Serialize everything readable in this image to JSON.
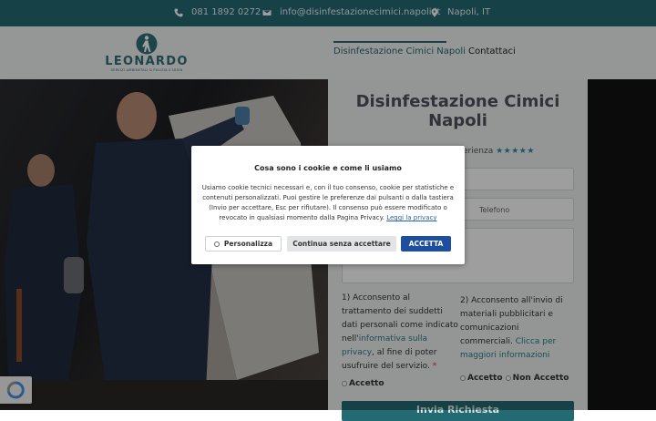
{
  "topbar": {
    "phone": "081 1892 0272",
    "email": "info@disinfestazionecimici.napoli.it",
    "location": "Napoli, IT"
  },
  "header": {
    "logo_text": "LEONARDO",
    "logo_sub": "SERVIZI AMBIENTALI & PULIZIA E DISIN",
    "nav": [
      {
        "label": "Disinfestazione Cimici Napoli",
        "active": true
      },
      {
        "label": "Contattaci",
        "active": false
      }
    ]
  },
  "form": {
    "title": "Disinfestazione Cimici Napoli",
    "rating_text": "erienza",
    "rating_stars": "★★★★★",
    "phone_placeholder": "Telefono",
    "consent1": "1) Acconsento al trattamento dei suddetti dati personali come indicato nell'",
    "consent1_link": "informativa sulla privacy",
    "consent1_tail": ", al fine di poter usufruire del servizio.",
    "consent1_required": "*",
    "consent1_option": "Accetto",
    "consent2": "2) Acconsento all'invio di materiali pubblicitari e comunicazioni commerciali.",
    "consent2_link": "Clicca per maggiori informazioni",
    "consent2_opt_yes": "Accetto",
    "consent2_opt_no": "Non Accetto",
    "submit_label": "Invia Richiesta"
  },
  "cookie_modal": {
    "title": "Cosa sono i cookie e come li usiamo",
    "body": "Usiamo cookie tecnici necessari e, con il tuo consenso, cookie per statistiche e contenuti personalizzati. Puoi gestire le preferenze dai pulsanti o dalla tastiera (Invio per accettare, Esc per rifiutare). Il consenso può essere modificato o revocato in qualsiasi momento dalla Pagina Privacy.",
    "privacy_link": "Leggi la privacy",
    "btn_customize": "Personalizza",
    "btn_continue": "Continua senza accettare",
    "btn_accept": "ACCETTA"
  },
  "colors": {
    "brand": "#236a73",
    "accept_button": "#1d4f9e"
  }
}
